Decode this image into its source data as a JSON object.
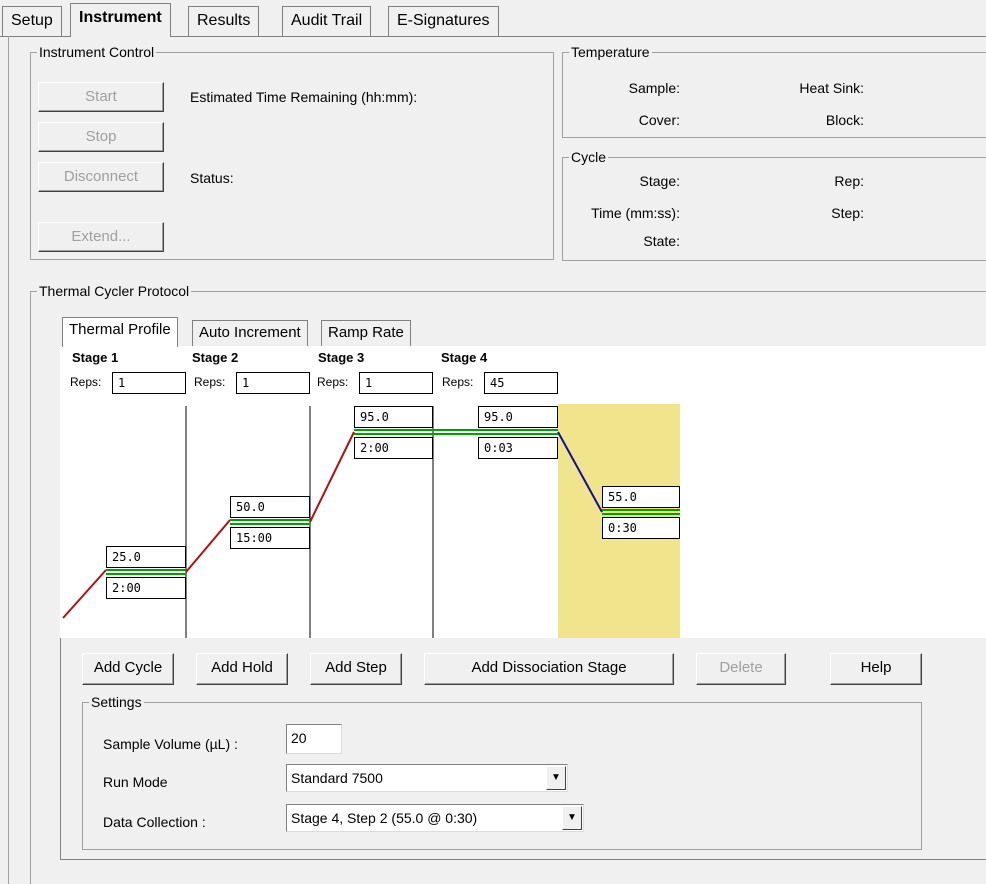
{
  "tabs": [
    "Setup",
    "Instrument",
    "Results",
    "Audit Trail",
    "E-Signatures"
  ],
  "instrument_control": {
    "title": "Instrument Control",
    "start": "Start",
    "stop": "Stop",
    "disconnect": "Disconnect",
    "extend": "Extend...",
    "time_remaining_label": "Estimated Time Remaining (hh:mm):",
    "status_label": "Status:"
  },
  "temperature": {
    "title": "Temperature",
    "sample": "Sample:",
    "cover": "Cover:",
    "heat_sink": "Heat Sink:",
    "block": "Block:"
  },
  "cycle": {
    "title": "Cycle",
    "stage": "Stage:",
    "time": "Time (mm:ss):",
    "state": "State:",
    "rep": "Rep:",
    "step": "Step:"
  },
  "protocol": {
    "title": "Thermal Cycler Protocol",
    "tabs": [
      "Thermal Profile",
      "Auto Increment",
      "Ramp Rate"
    ],
    "reps_label": "Reps:",
    "stages": [
      {
        "title": "Stage 1",
        "reps": "1",
        "steps": [
          {
            "temp": "25.0",
            "time": "2:00"
          }
        ]
      },
      {
        "title": "Stage 2",
        "reps": "1",
        "steps": [
          {
            "temp": "50.0",
            "time": "15:00"
          }
        ]
      },
      {
        "title": "Stage 3",
        "reps": "1",
        "steps": [
          {
            "temp": "95.0",
            "time": "2:00"
          }
        ]
      },
      {
        "title": "Stage 4",
        "reps": "45",
        "steps": [
          {
            "temp": "95.0",
            "time": "0:03"
          },
          {
            "temp": "55.0",
            "time": "0:30"
          }
        ]
      }
    ],
    "colors": {
      "hold": "#00a000",
      "ramp_up": "#b01010",
      "ramp_down": "#1010a0",
      "highlight": "#f0e48c"
    }
  },
  "actions": {
    "add_cycle": "Add Cycle",
    "add_hold": "Add Hold",
    "add_step": "Add Step",
    "add_dissociation": "Add Dissociation Stage",
    "delete": "Delete",
    "help": "Help"
  },
  "settings": {
    "title": "Settings",
    "sample_volume_label": "Sample Volume (µL) :",
    "sample_volume": "20",
    "run_mode_label": "Run Mode",
    "run_mode": "Standard 7500",
    "data_collection_label": "Data Collection :",
    "data_collection": "Stage 4, Step 2 (55.0 @ 0:30)"
  }
}
